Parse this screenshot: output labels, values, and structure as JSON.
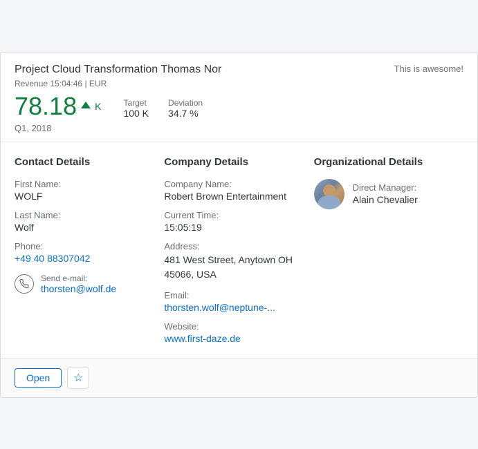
{
  "header": {
    "project_title": "Project Cloud Transformation Thomas Nor",
    "awesome_tag": "This is awesome!",
    "revenue_label": "Revenue",
    "time": "15:04:46",
    "currency": "EUR",
    "main_value": "78.18",
    "main_unit": "K",
    "target_label": "Target",
    "target_value": "100 K",
    "deviation_label": "Deviation",
    "deviation_value": "34.7 %",
    "quarter": "Q1, 2018"
  },
  "contact": {
    "section_title": "Contact Details",
    "first_name_label": "First Name:",
    "first_name": "WOLF",
    "last_name_label": "Last Name:",
    "last_name": "Wolf",
    "phone_label": "Phone:",
    "phone": "+49 40 88307042",
    "send_email_label": "Send e-mail:",
    "email_link": "thorsten@wolf.de",
    "phone_icon": "☎"
  },
  "company": {
    "section_title": "Company Details",
    "company_name_label": "Company Name:",
    "company_name": "Robert Brown Entertainment",
    "current_time_label": "Current Time:",
    "current_time": "15:05:19",
    "address_label": "Address:",
    "address": "481 West Street, Anytown OH 45066, USA",
    "email_label": "Email:",
    "email_link": "thorsten.wolf@neptune-...",
    "website_label": "Website:",
    "website_link": "www.first-daze.de"
  },
  "org": {
    "section_title": "Organizational Details",
    "manager_label": "Direct Manager:",
    "manager_name": "Alain Chevalier"
  },
  "footer": {
    "open_button": "Open",
    "star_icon": "☆"
  }
}
